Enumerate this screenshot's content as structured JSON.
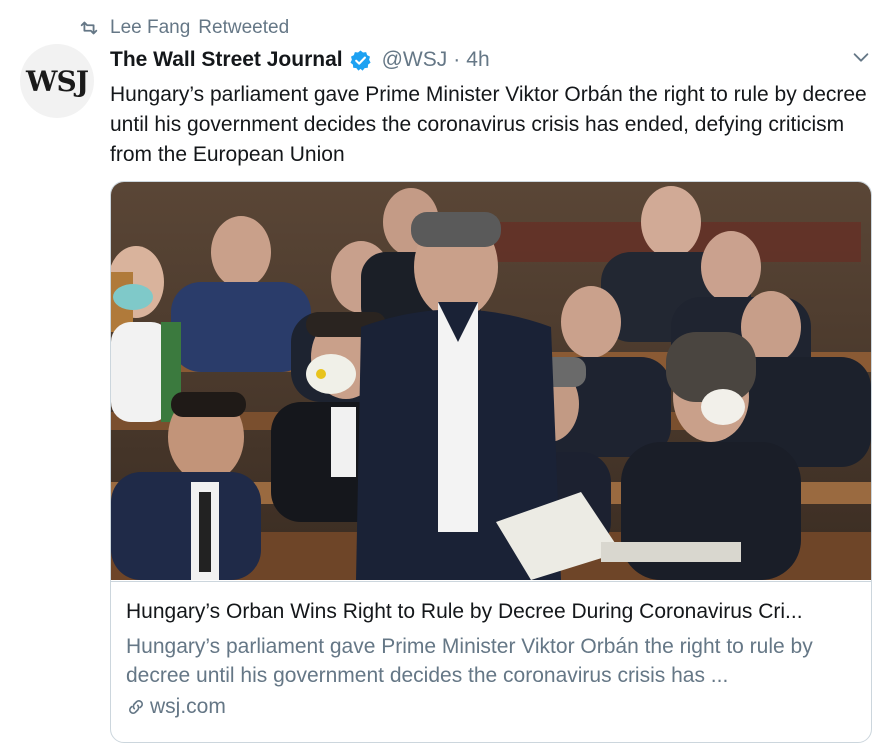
{
  "retweet": {
    "icon": "retweet-icon",
    "user": "Lee Fang",
    "label": "Retweeted"
  },
  "author": {
    "avatar_text": "WSJ",
    "name": "The Wall Street Journal",
    "verified_icon": "verified-badge-icon",
    "handle": "@WSJ",
    "separator": "·",
    "time": "4h"
  },
  "menu_icon": "chevron-down-icon",
  "tweet": {
    "text": "Hungary’s parliament gave Prime Minister Viktor Orbán the right to rule by decree until his government decides the coronavirus crisis has ended, defying criticism from the European Union"
  },
  "card": {
    "image_icon": "article-photo",
    "title": "Hungary’s Orban Wins Right to Rule by Decree During Coronavirus Cri...",
    "description": "Hungary’s parliament gave Prime Minister Viktor Orbán the right to rule by decree until his government decides the coronavirus crisis has ...",
    "domain_icon": "link-icon",
    "domain": "wsj.com"
  },
  "colors": {
    "text": "#14171a",
    "secondary": "#657786",
    "verified": "#1da1f2",
    "border": "#ccd6dd"
  }
}
